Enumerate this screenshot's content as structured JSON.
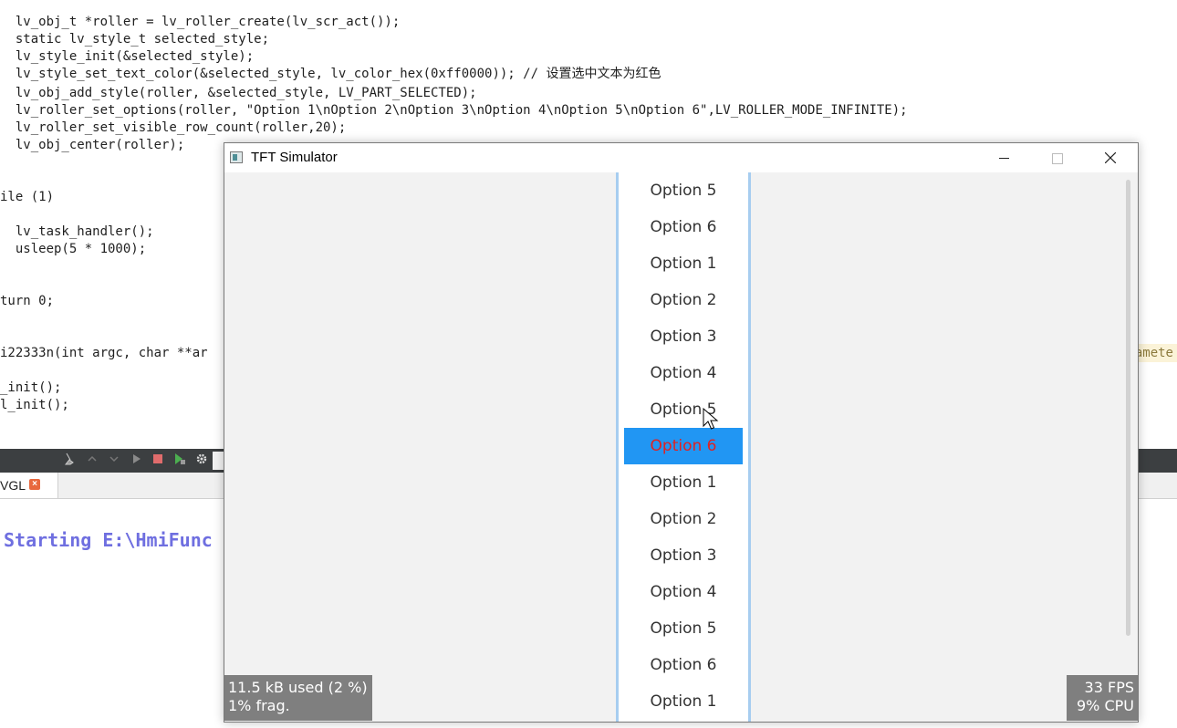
{
  "code_lines": [
    "  lv_obj_t *roller = lv_roller_create(lv_scr_act());",
    "  static lv_style_t selected_style;",
    "  lv_style_init(&selected_style);",
    "  lv_style_set_text_color(&selected_style, lv_color_hex(0xff0000)); // 设置选中文本为红色",
    "  lv_obj_add_style(roller, &selected_style, LV_PART_SELECTED);",
    "  lv_roller_set_options(roller, \"Option 1\\nOption 2\\nOption 3\\nOption 4\\nOption 5\\nOption 6\",LV_ROLLER_MODE_INFINITE);",
    "  lv_roller_set_visible_row_count(roller,20);",
    "  lv_obj_center(roller);",
    "",
    "",
    "ile (1)",
    "",
    "  lv_task_handler();",
    "  usleep(5 * 1000);",
    "",
    "",
    "turn 0;",
    "",
    "",
    "i22333n(int argc, char **ar",
    "",
    "_init();",
    "l_init();"
  ],
  "param_hint": "amete",
  "tab": {
    "label": "VGL",
    "close": "×"
  },
  "output": {
    "text": "Starting E:\\HmiFunc"
  },
  "toolbar_icons": [
    "broom-icon",
    "up-icon",
    "down-icon",
    "run-icon",
    "stop-icon",
    "attach-icon",
    "gear-icon"
  ],
  "window": {
    "title": "TFT Simulator"
  },
  "roller": {
    "options_above": [
      "Option 5",
      "Option 6",
      "Option 1",
      "Option 2",
      "Option 3",
      "Option 4",
      "Option 5"
    ],
    "selected": "Option 6",
    "options_below": [
      "Option 1",
      "Option 2",
      "Option 3",
      "Option 4",
      "Option 5",
      "Option 6",
      "Option 1"
    ],
    "selected_text_color": "#e02222",
    "selected_bg_color": "#2196f3"
  },
  "stats": {
    "memory": "11.5 kB used (2 %)",
    "fragmentation": "1% frag.",
    "fps": "33 FPS",
    "cpu": "9% CPU"
  }
}
